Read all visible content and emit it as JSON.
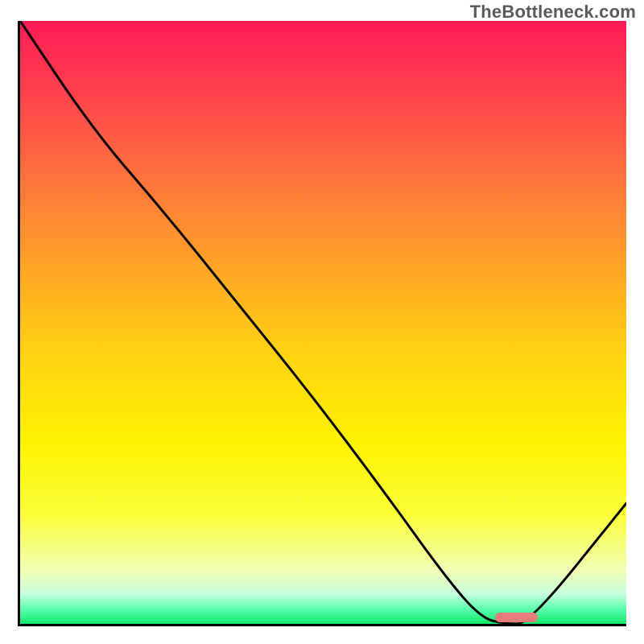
{
  "watermark": "TheBottleneck.com",
  "chart_data": {
    "type": "line",
    "title": "",
    "xlabel": "",
    "ylabel": "",
    "xlim": [
      0,
      100
    ],
    "ylim": [
      0,
      100
    ],
    "grid": false,
    "series": [
      {
        "name": "bottleneck-curve",
        "x": [
          0,
          12,
          24,
          36,
          48,
          60,
          70,
          76,
          80,
          84,
          100
        ],
        "y": [
          100,
          82,
          68,
          53,
          38,
          22,
          8,
          1,
          0,
          0,
          20
        ]
      }
    ],
    "annotations": [
      {
        "name": "optimal-range-marker",
        "x_start": 78,
        "x_end": 85,
        "y": 0
      }
    ],
    "gradient_stops": [
      {
        "pos": 0.0,
        "color": "#ff1b55"
      },
      {
        "pos": 0.1,
        "color": "#ff3b4f"
      },
      {
        "pos": 0.25,
        "color": "#ff6f3e"
      },
      {
        "pos": 0.4,
        "color": "#ffa227"
      },
      {
        "pos": 0.55,
        "color": "#ffd212"
      },
      {
        "pos": 0.7,
        "color": "#fff300"
      },
      {
        "pos": 0.82,
        "color": "#fcff3a"
      },
      {
        "pos": 0.91,
        "color": "#f2ffb3"
      },
      {
        "pos": 0.95,
        "color": "#c8ffdc"
      },
      {
        "pos": 0.975,
        "color": "#5dffad"
      },
      {
        "pos": 1.0,
        "color": "#13e86a"
      }
    ]
  }
}
